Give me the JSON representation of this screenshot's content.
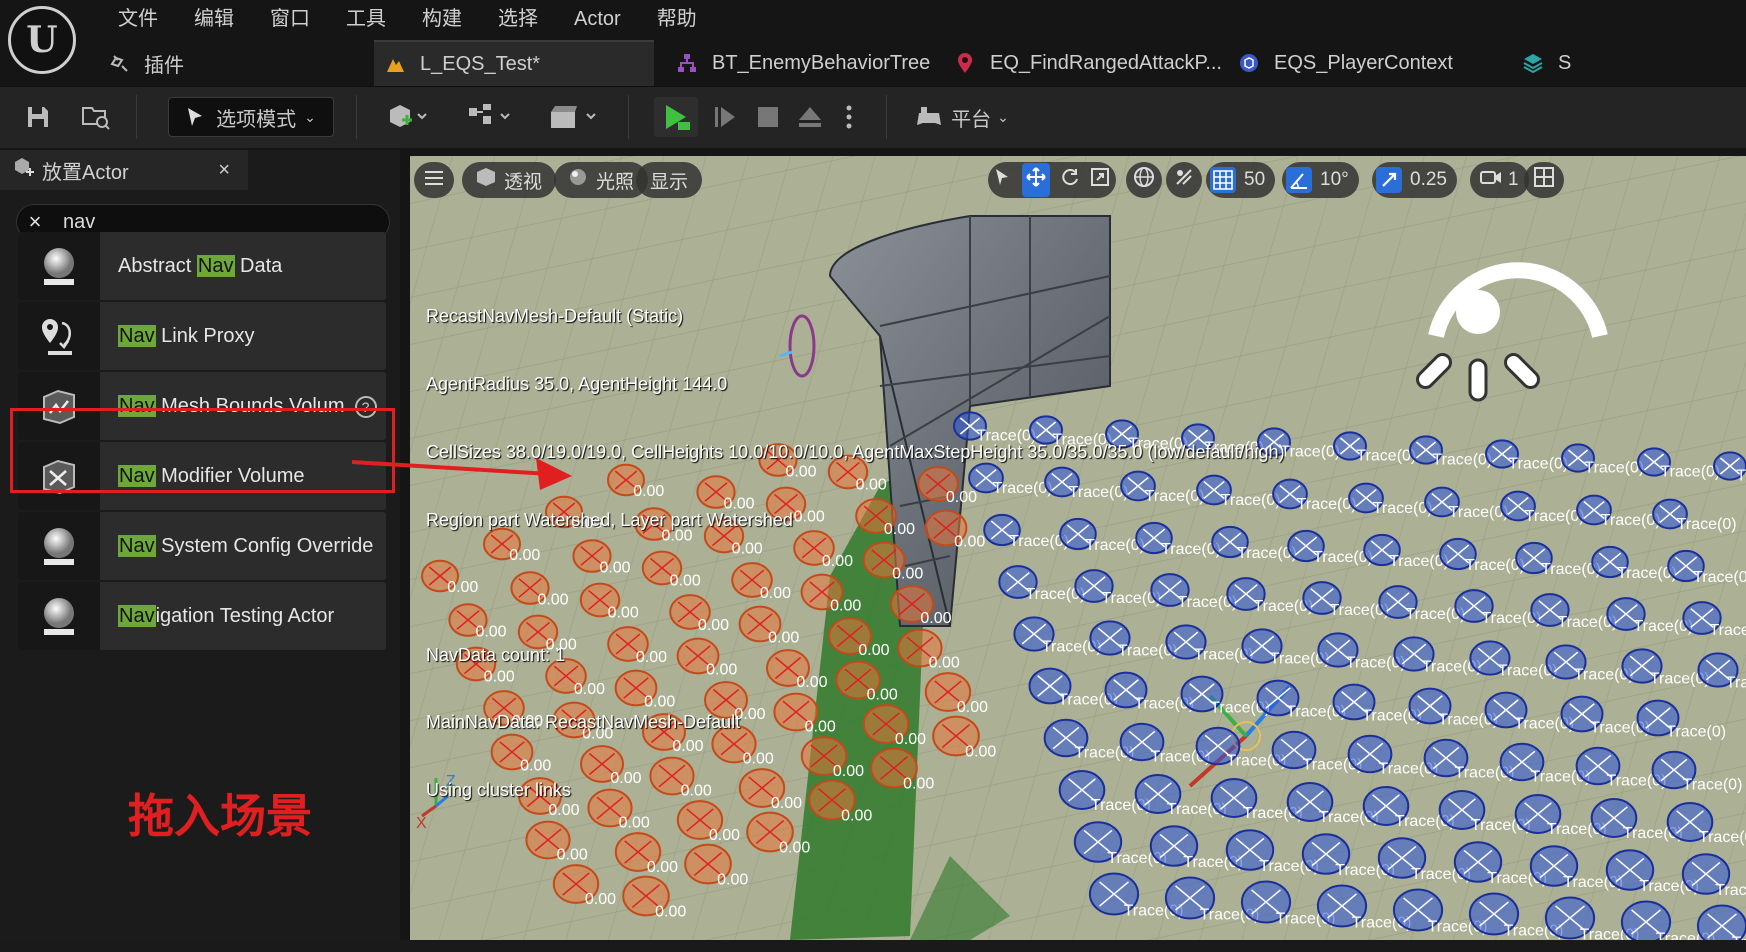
{
  "menu": [
    "文件",
    "编辑",
    "窗口",
    "工具",
    "构建",
    "选择",
    "Actor",
    "帮助"
  ],
  "tabs": {
    "plugin": "插件",
    "level": "L_EQS_Test*",
    "bt": "BT_EnemyBehaviorTree",
    "eq": "EQ_FindRangedAttackP...",
    "ctx": "EQS_PlayerContext",
    "more": "S"
  },
  "toolbar": {
    "select_mode": "选项模式",
    "platform": "平台"
  },
  "panel": {
    "title": "放置Actor",
    "search_value": "nav",
    "items": [
      {
        "pre": "Abstract ",
        "hl": "Nav",
        "post": " Data"
      },
      {
        "pre": "",
        "hl": "Nav",
        "post": " Link Proxy"
      },
      {
        "pre": "",
        "hl": "Nav",
        "post": " Mesh Bounds Volum"
      },
      {
        "pre": "",
        "hl": "Nav",
        "post": " Modifier Volume"
      },
      {
        "pre": "",
        "hl": "Nav",
        "post": " System Config Override"
      },
      {
        "pre": "",
        "hl": "Nav",
        "post": "igation Testing Actor"
      }
    ],
    "annotation": "拖入场景"
  },
  "viewport": {
    "perspective": "透视",
    "lighting": "光照",
    "show": "显示",
    "grid_snap": "50",
    "rot_snap": "10°",
    "scale_snap": "0.25",
    "cam_speed": "1",
    "navinfo": [
      "RecastNavMesh-Default (Static)",
      "AgentRadius 35.0, AgentHeight 144.0",
      "CellSizes 38.0/19.0/19.0, CellHeights 10.0/10.0/10.0, AgentMaxStepHeight 35.0/35.0/35.0 (low/default/high)",
      "Region part Watershed, Layer part Watershed",
      "",
      "NavData count: 1",
      "MainNavData: RecastNavMesh-Default",
      "Using cluster links"
    ],
    "score_label": "0.00",
    "trace_label": "Trace(0)",
    "axes": {
      "x": "X",
      "z": "Z"
    }
  },
  "colors": {
    "highlight": "#6fa83a",
    "annotation_red": "#e02020",
    "floor": "#a6ab8e",
    "navmesh_green": "#2f7a2c",
    "orange_point": "#e8763a",
    "blue_point": "#2b55d8"
  }
}
